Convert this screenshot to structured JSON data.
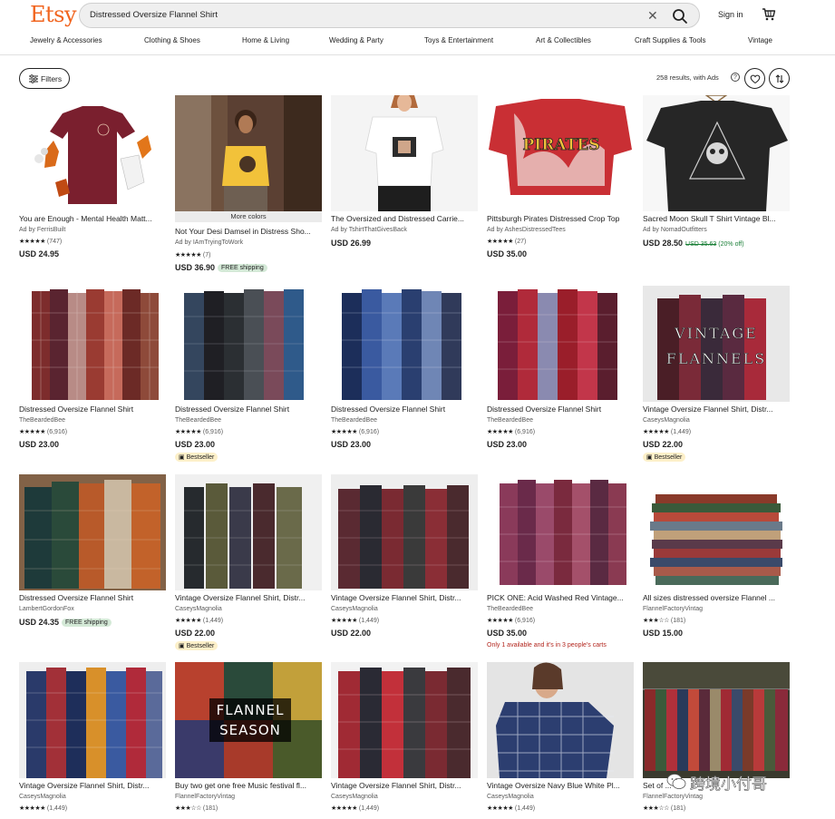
{
  "header": {
    "logo": "Etsy",
    "search_value": "Distressed Oversize Flannel Shirt",
    "clear_icon": "close-icon",
    "search_icon": "search-icon",
    "signin_label": "Sign in",
    "cart_icon": "cart-icon"
  },
  "nav": [
    "Jewelry & Accessories",
    "Clothing & Shoes",
    "Home & Living",
    "Wedding & Party",
    "Toys & Entertainment",
    "Art & Collectibles",
    "Craft Supplies & Tools",
    "Vintage"
  ],
  "toolbar": {
    "filters_label": "Filters",
    "results_text": "258 results, with Ads",
    "help_icon": "?",
    "favorite_icon": "heart-icon",
    "sort_icon": "sort-icon"
  },
  "colors": {
    "brand": "#F1641E",
    "free_shipping_bg": "#d4e9d7",
    "bestseller_bg": "#fdf0c9",
    "sale_green": "#1a7f37",
    "scarcity_red": "#b3261e"
  },
  "items": [
    {
      "title": "You are Enough - Mental Health Matt...",
      "shop": "Ad by FerrisBuilt",
      "stars": "★★★★★",
      "reviews": "(747)",
      "price": "USD 24.95"
    },
    {
      "title": "Not Your Desi Damsel in Distress Sho...",
      "shop": "Ad by IAmTryingToWork",
      "stars": "★★★★★",
      "reviews": "(7)",
      "price": "USD 36.90",
      "free": "FREE shipping",
      "more_colors": "More colors"
    },
    {
      "title": "The Oversized and Distressed Carrie...",
      "shop": "Ad by TshirtThatGivesBack",
      "stars": "",
      "reviews": "",
      "price": "USD 26.99"
    },
    {
      "title": "Pittsburgh Pirates Distressed Crop Top",
      "shop": "Ad by AshesDistressedTees",
      "stars": "★★★★★",
      "reviews": "(27)",
      "price": "USD 35.00"
    },
    {
      "title": "Sacred Moon Skull T Shirt Vintage Bl...",
      "shop": "Ad by NomadOutfitters",
      "stars": "",
      "reviews": "",
      "price": "USD 28.50",
      "orig": "USD 35.63",
      "disc": "(20% off)"
    },
    {
      "title": "Distressed Oversize Flannel Shirt",
      "shop": "TheBeardedBee",
      "stars": "★★★★★",
      "reviews": "(6,916)",
      "price": "USD 23.00"
    },
    {
      "title": "Distressed Oversize Flannel Shirt",
      "shop": "TheBeardedBee",
      "stars": "★★★★★",
      "reviews": "(6,916)",
      "price": "USD 23.00",
      "bestseller": "Bestseller"
    },
    {
      "title": "Distressed Oversize Flannel Shirt",
      "shop": "TheBeardedBee",
      "stars": "★★★★★",
      "reviews": "(6,916)",
      "price": "USD 23.00"
    },
    {
      "title": "Distressed Oversize Flannel Shirt",
      "shop": "TheBeardedBee",
      "stars": "★★★★★",
      "reviews": "(6,916)",
      "price": "USD 23.00"
    },
    {
      "title": "Vintage Oversize Flannel Shirt, Distr...",
      "shop": "CaseysMagnolia",
      "stars": "★★★★★",
      "reviews": "(1,449)",
      "price": "USD 22.00",
      "bestseller": "Bestseller"
    },
    {
      "title": "Distressed Oversize Flannel Shirt",
      "shop": "LambertGordonFox",
      "stars": "",
      "reviews": "",
      "price": "USD 24.35",
      "free": "FREE shipping"
    },
    {
      "title": "Vintage Oversize Flannel Shirt, Distr...",
      "shop": "CaseysMagnolia",
      "stars": "★★★★★",
      "reviews": "(1,449)",
      "price": "USD 22.00",
      "bestseller": "Bestseller"
    },
    {
      "title": "Vintage Oversize Flannel Shirt, Distr...",
      "shop": "CaseysMagnolia",
      "stars": "★★★★★",
      "reviews": "(1,449)",
      "price": "USD 22.00"
    },
    {
      "title": "PICK ONE: Acid Washed Red Vintage...",
      "shop": "TheBeardedBee",
      "stars": "★★★★★",
      "reviews": "(6,916)",
      "price": "USD 35.00",
      "scarcity": "Only 1 available and it's in 3 people's carts"
    },
    {
      "title": "All sizes distressed oversize Flannel ...",
      "shop": "FlannelFactoryVintag",
      "stars": "★★★☆☆",
      "reviews": "(181)",
      "price": "USD 15.00"
    },
    {
      "title": "Vintage Oversize Flannel Shirt, Distr...",
      "shop": "CaseysMagnolia",
      "stars": "★★★★★",
      "reviews": "(1,449)",
      "price": ""
    },
    {
      "title": "Buy two get one free Music festival fl...",
      "shop": "FlannelFactoryVintag",
      "stars": "★★★☆☆",
      "reviews": "(181)",
      "price": "",
      "overlay": "FLANNEL SEASON"
    },
    {
      "title": "Vintage Oversize Flannel Shirt, Distr...",
      "shop": "CaseysMagnolia",
      "stars": "★★★★★",
      "reviews": "(1,449)",
      "price": ""
    },
    {
      "title": "Vintage Oversize Navy Blue White Pl...",
      "shop": "CaseysMagnolia",
      "stars": "★★★★★",
      "reviews": "(1,449)",
      "price": ""
    },
    {
      "title": "Set of ...",
      "shop": "FlannelFactoryVintag",
      "stars": "★★★☆☆",
      "reviews": "(181)",
      "price": ""
    }
  ],
  "overlays": {
    "item4_line1": "PIRATES",
    "item5_line1": "VINTAGE",
    "item5_line2": "FLANNELS",
    "item10_line1": "VINTAGE",
    "item10_line2": "FLANNELS",
    "item17_line1": "FLANNEL",
    "item17_line2": "SEASON"
  },
  "watermark": "跨境小付哥"
}
